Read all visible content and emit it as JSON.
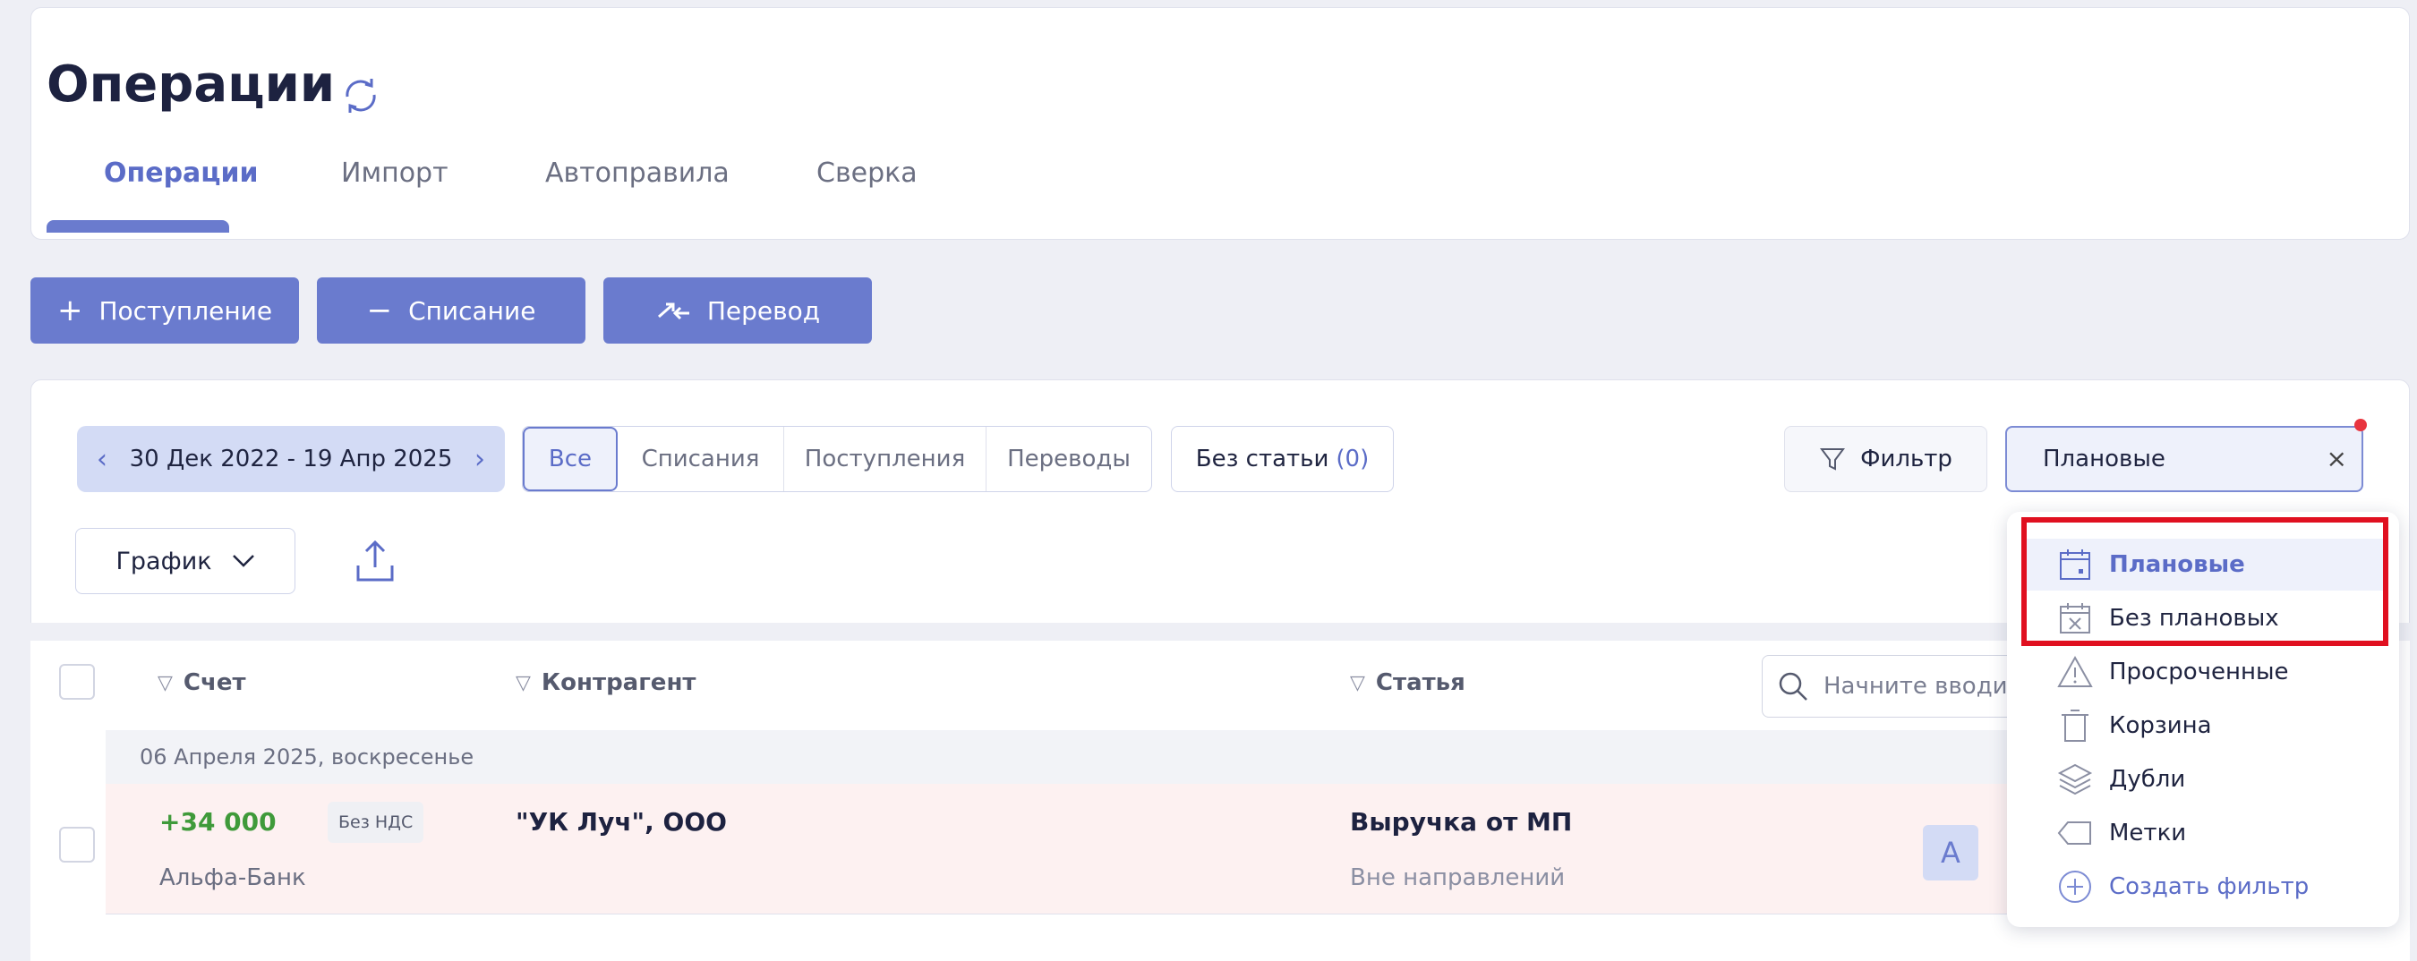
{
  "header": {
    "title": "Операции",
    "tabs": [
      {
        "label": "Операции",
        "active": true
      },
      {
        "label": "Импорт",
        "active": false
      },
      {
        "label": "Автоправила",
        "active": false
      },
      {
        "label": "Сверка",
        "active": false
      }
    ]
  },
  "actions": {
    "income_label": "Поступление",
    "expense_label": "Списание",
    "transfer_label": "Перевод"
  },
  "filters": {
    "date_range": "30 Дек 2022 - 19 Апр 2025",
    "type_tabs": [
      {
        "label": "Все",
        "active": true
      },
      {
        "label": "Списания",
        "active": false
      },
      {
        "label": "Поступления",
        "active": false
      },
      {
        "label": "Переводы",
        "active": false
      }
    ],
    "no_article_label": "Без статьи",
    "no_article_count": "(0)",
    "filter_label": "Фильтр",
    "plan_select_value": "Плановые",
    "view_label": "График"
  },
  "table": {
    "columns": {
      "account": "Счет",
      "counterparty": "Контрагент",
      "article": "Статья"
    },
    "search_placeholder": "Начните вводить",
    "group_date": "06 Апреля 2025, воскресенье",
    "row": {
      "amount": "+34 000",
      "vat": "Без НДС",
      "account": "Альфа-Банк",
      "counterparty": "\"УК Луч\", ООО",
      "article": "Выручка от МП",
      "direction": "Вне направлений",
      "avatar": "А"
    }
  },
  "dropdown": {
    "items": [
      {
        "label": "Плановые",
        "icon": "calendar-dot-icon",
        "selected": true
      },
      {
        "label": "Без плановых",
        "icon": "calendar-x-icon",
        "selected": false
      },
      {
        "label": "Просроченные",
        "icon": "warning-icon",
        "selected": false
      },
      {
        "label": "Корзина",
        "icon": "trash-icon",
        "selected": false
      },
      {
        "label": "Дубли",
        "icon": "layers-icon",
        "selected": false
      },
      {
        "label": "Метки",
        "icon": "tag-icon",
        "selected": false
      }
    ],
    "create_label": "Создать фильтр"
  },
  "colors": {
    "accent": "#6a7bce",
    "income_green": "#3f9a3a",
    "highlight_red": "#e01020"
  }
}
